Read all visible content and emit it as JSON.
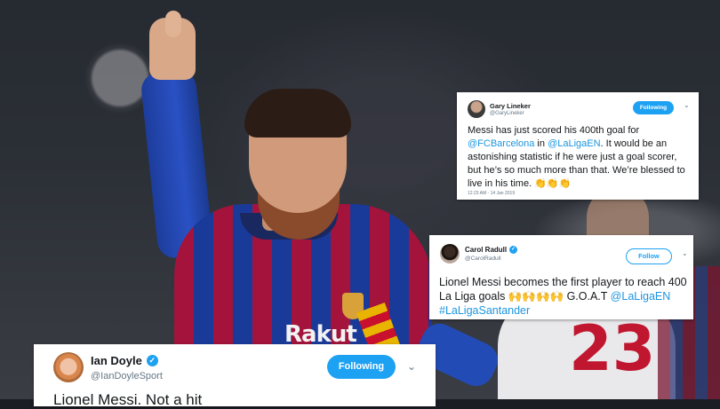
{
  "photo": {
    "sponsor_text": "Rakut",
    "background_number": "23"
  },
  "tweets": [
    {
      "name": "Gary Lineker",
      "handle": "@GaryLineker",
      "verified": true,
      "follow_label": "Following",
      "text_parts": [
        {
          "t": "Messi has just scored his 400th goal for ",
          "link": false
        },
        {
          "t": "@FCBarcelona",
          "link": true
        },
        {
          "t": " in ",
          "link": false
        },
        {
          "t": "@LaLigaEN",
          "link": true
        },
        {
          "t": ". It would be an astonishing statistic if he were just a goal scorer, but he’s so much more than that. We’re blessed to live in his time. ",
          "link": false
        },
        {
          "t": "👏👏👏",
          "link": false
        }
      ],
      "timestamp": "12:23 AM - 14 Jan 2019"
    },
    {
      "name": "Carol Radull",
      "handle": "@CarolRadull",
      "verified": true,
      "follow_label": "Follow",
      "text_parts": [
        {
          "t": "Lionel Messi becomes the first player to reach 400 La Liga goals ",
          "link": false
        },
        {
          "t": "🙌🙌🙌🙌",
          "link": false
        },
        {
          "t": " G.O.A.T ",
          "link": false
        },
        {
          "t": "@LaLigaEN",
          "link": true
        },
        {
          "t": " ",
          "link": false
        },
        {
          "t": "#LaLigaSantander",
          "link": true
        }
      ]
    },
    {
      "name": "Ian Doyle",
      "handle": "@IanDoyleSport",
      "verified": true,
      "follow_label": "Following",
      "text_parts": [
        {
          "t": "Lionel Messi. Not a hit",
          "link": false
        }
      ]
    }
  ],
  "icons": {
    "verified": "verified-badge-icon",
    "chevron": "chevron-down-icon"
  }
}
